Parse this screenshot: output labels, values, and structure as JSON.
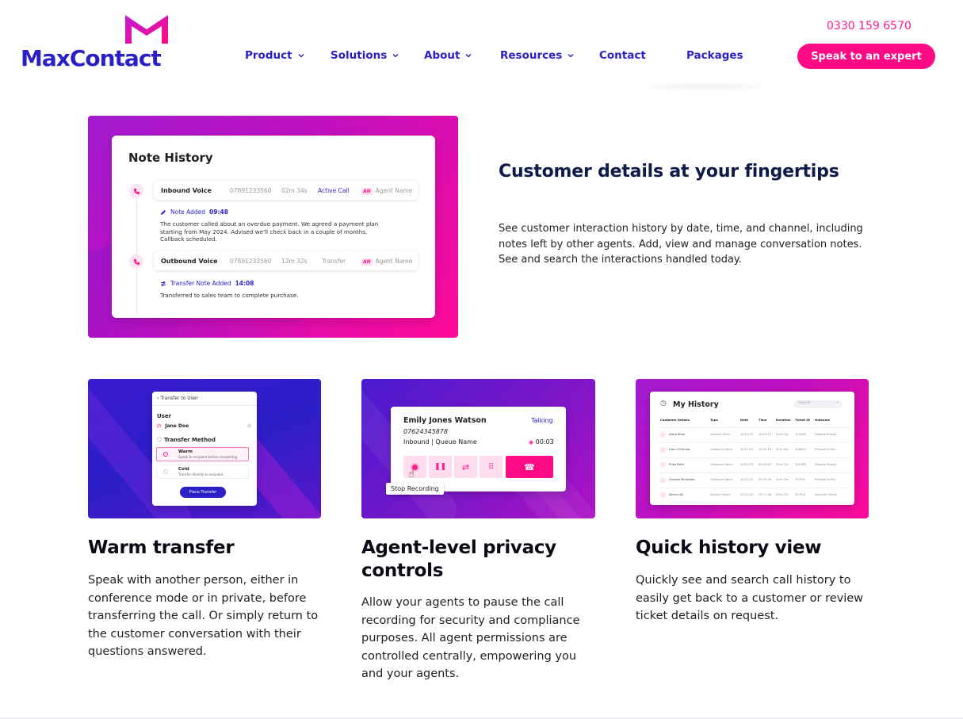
{
  "brand": {
    "name": "MaxContact",
    "accent_pink": "#ff0a84",
    "accent_blue": "#2b1fc7"
  },
  "nav": {
    "items": [
      {
        "label": "Product",
        "has_dropdown": true
      },
      {
        "label": "Solutions",
        "has_dropdown": true
      },
      {
        "label": "About",
        "has_dropdown": true
      },
      {
        "label": "Resources",
        "has_dropdown": true
      },
      {
        "label": "Contact",
        "has_dropdown": false
      },
      {
        "label": "Packages",
        "has_dropdown": false
      }
    ],
    "phone": "0330 159 6570",
    "cta_label": "Speak to an expert"
  },
  "hero": {
    "title": "Customer details at your fingertips",
    "description": "See customer interaction history by date, time, and channel, including notes left by other agents. Add, view and manage conversation notes. See and search the interactions handled today.",
    "note_history": {
      "title": "Note History",
      "calls": [
        {
          "type": "Inbound Voice",
          "number": "07891233560",
          "duration": "02m 34s",
          "status": "Active Call",
          "agent_initials": "AN",
          "agent": "Agent Name",
          "note_label": "Note Added",
          "note_time": "09:48",
          "note_lines": [
            "The customer called about an overdue payment. We agreed a payment plan",
            "starting from May 2024. Advised we'll check back in a couple of months.",
            "Callback scheduled."
          ]
        },
        {
          "type": "Outbound Voice",
          "number": "07891233560",
          "duration": "12m 32s",
          "status": "Transfer",
          "agent_initials": "AN",
          "agent": "Agent Name",
          "note_label": "Transfer Note Added",
          "note_time": "14:08",
          "note_lines": [
            "Transferred to sales team to complete purchase."
          ]
        }
      ]
    }
  },
  "features": {
    "warm_transfer": {
      "title": "Warm transfer",
      "description": "Speak with another person, either in conference mode or in private, before transferring the call. Or simply return to the customer conversation with their questions answered.",
      "mock": {
        "header": "Transfer to User",
        "user_label": "User",
        "user_initials": "JD",
        "user_name": "Jane Doe",
        "method_label": "Transfer Method",
        "options": [
          {
            "label": "Warm",
            "sub": "Speak to recipient before completing",
            "selected": true
          },
          {
            "label": "Cold",
            "sub": "Transfer directly to recipient",
            "selected": false
          }
        ],
        "button": "Place Transfer"
      }
    },
    "privacy": {
      "title_line1": "Agent-level privacy",
      "title_line2": "controls",
      "description": "Allow your agents to pause the call recording for security and compliance purposes. All agent permissions are controlled centrally, empowering you and your agents.",
      "mock": {
        "name": "Emily Jones Watson",
        "status": "Talking",
        "number": "07624345878",
        "queue": "Inbound | Queue Name",
        "timer": "00:03",
        "tooltip": "Stop Recording"
      }
    },
    "history": {
      "title": "Quick history view",
      "description": "Quickly see and search call history to easily get back to a customer or review ticket details on request.",
      "mock": {
        "title": "My History",
        "search_placeholder": "Search",
        "columns": [
          "Customer Details",
          "Type",
          "Date",
          "Time",
          "Duration",
          "Ticket ID",
          "Outcome"
        ],
        "rows": [
          [
            "Aisha Khan",
            "Inbound Voice",
            "15/11/23",
            "10:13:15",
            "01m 23s",
            "123456",
            "Dispute Raised"
          ],
          [
            "Liam O'Connor",
            "Outbound Voice",
            "15/11/23",
            "10:02:19",
            "02m 45s",
            "246810",
            "Promise to Pay"
          ],
          [
            "Priya Patel",
            "Outbound Voice",
            "15/11/23",
            "09:54:47",
            "05m 12s",
            "241368",
            "Dispute Raised"
          ],
          [
            "Carmen Mcdonald",
            "Outbound Voice",
            "15/11/23",
            "09:32:34",
            "04m 15s",
            "357924",
            "Promise to Pay"
          ],
          [
            "Samira Ali",
            "Inbound Voice",
            "15/11/23",
            "09:17:48",
            "03m 27s",
            "357924",
            "Account Closed"
          ]
        ]
      }
    }
  }
}
